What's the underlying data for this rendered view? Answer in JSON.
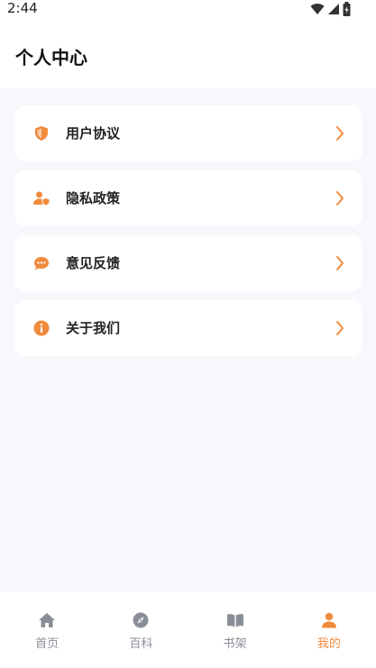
{
  "status_bar": {
    "time": "2:44"
  },
  "header": {
    "title": "个人中心"
  },
  "menu": [
    {
      "label": "用户协议",
      "icon": "shield-icon"
    },
    {
      "label": "隐私政策",
      "icon": "user-shield-icon"
    },
    {
      "label": "意见反馈",
      "icon": "chat-bubble-icon"
    },
    {
      "label": "关于我们",
      "icon": "info-icon"
    }
  ],
  "tabs": [
    {
      "label": "首页",
      "icon": "home-icon",
      "active": false
    },
    {
      "label": "百科",
      "icon": "compass-icon",
      "active": false
    },
    {
      "label": "书架",
      "icon": "book-icon",
      "active": false
    },
    {
      "label": "我的",
      "icon": "person-icon",
      "active": true
    }
  ],
  "colors": {
    "accent": "#f08a3c",
    "inactive": "#8a8f97",
    "background": "#f6f8fb"
  }
}
